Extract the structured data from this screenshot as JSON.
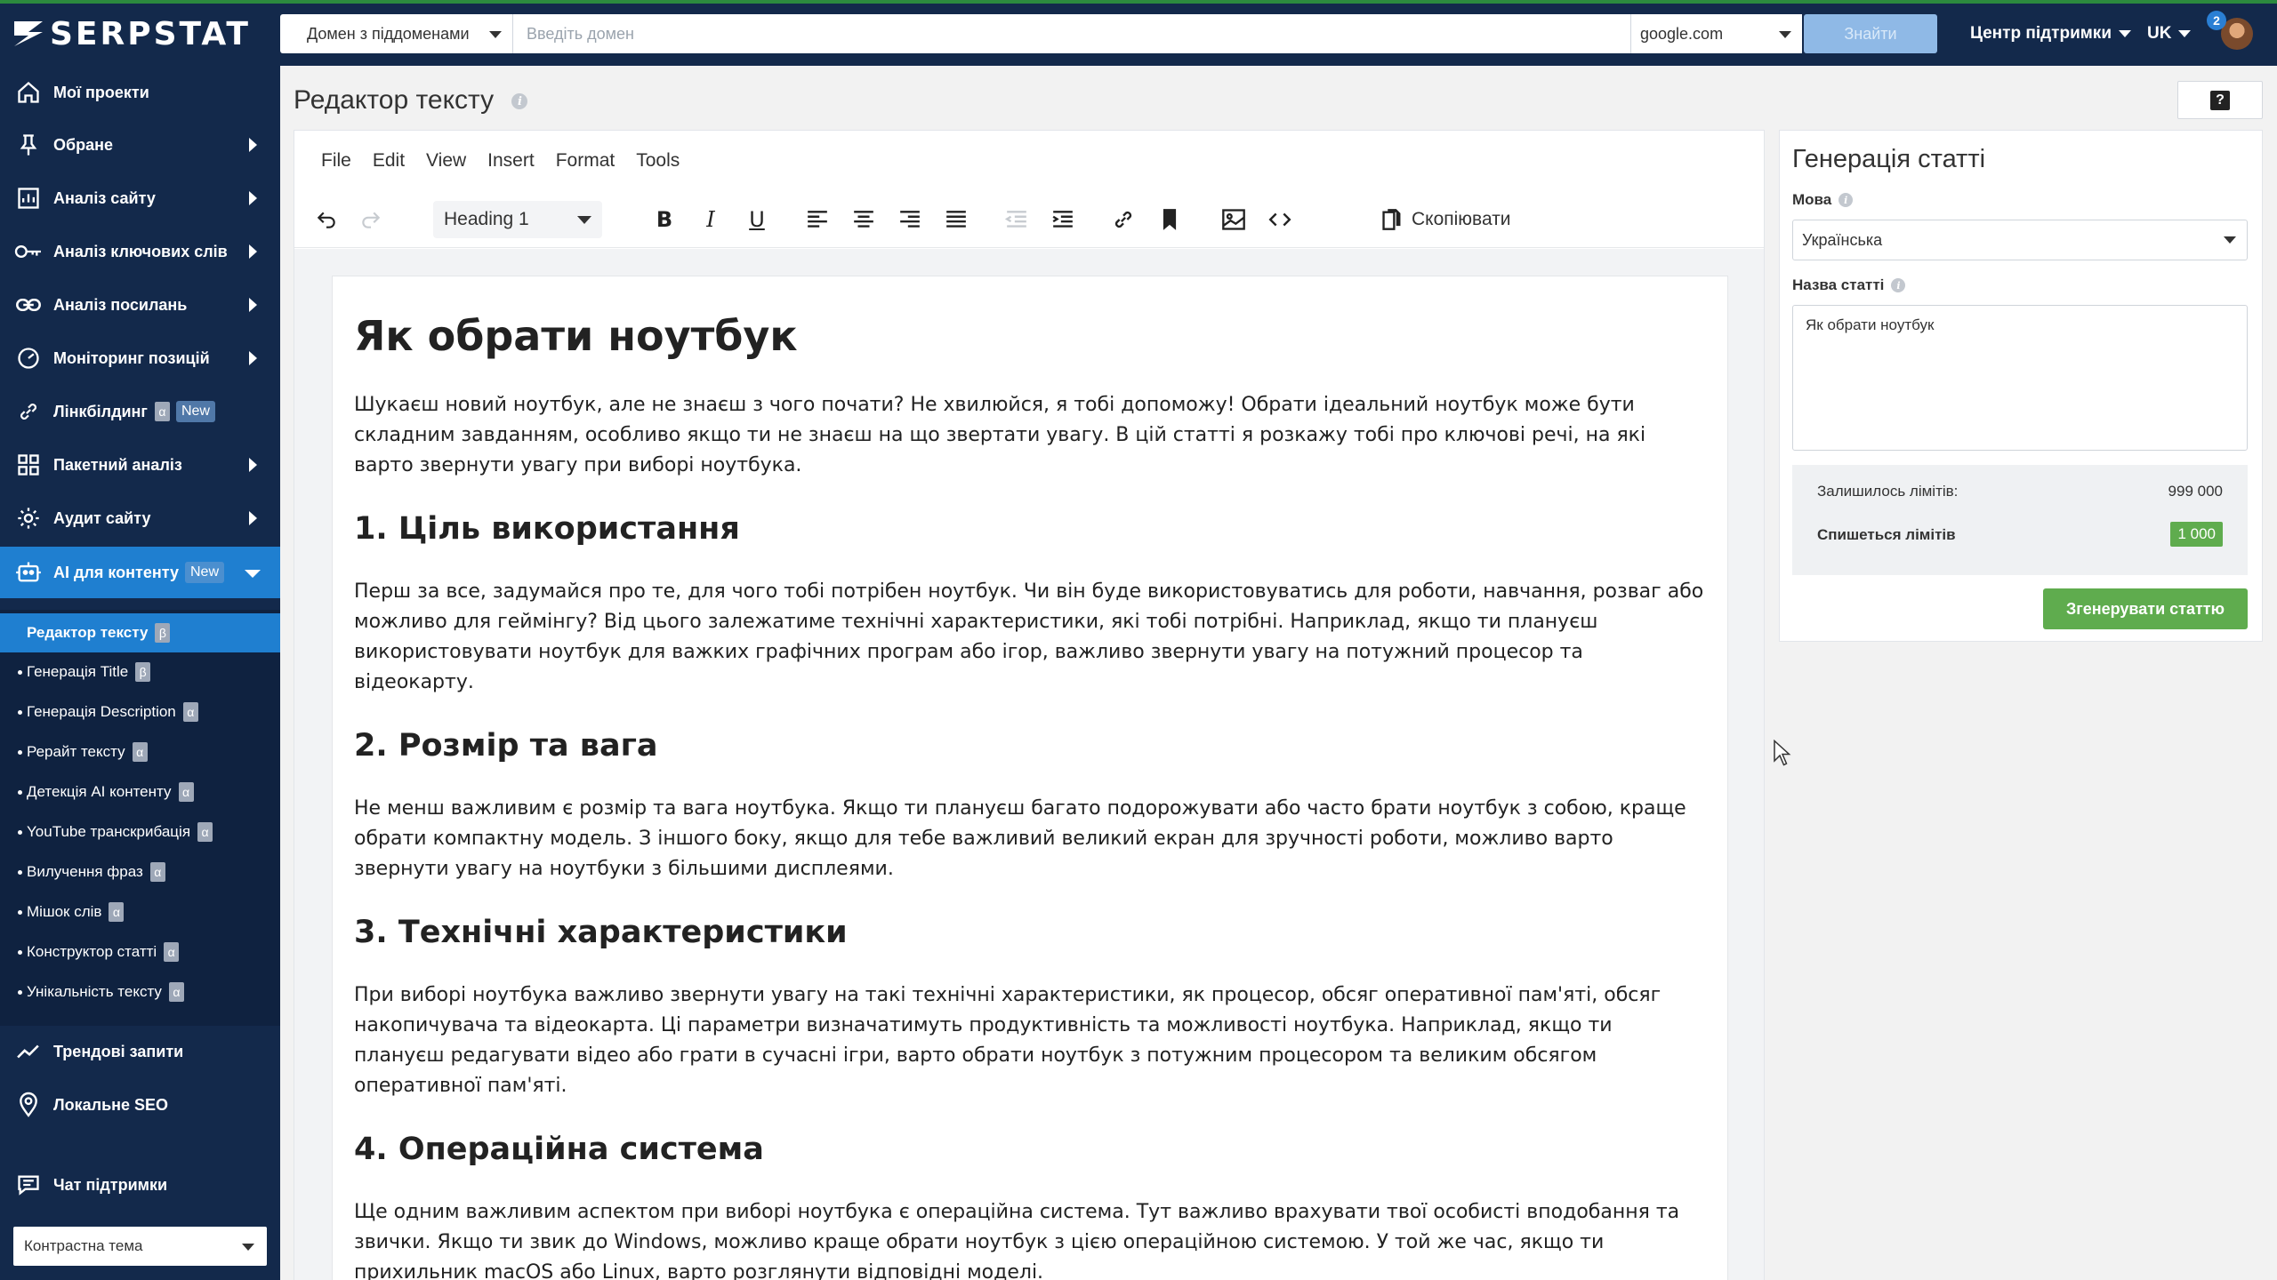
{
  "brand": {
    "logo_text": "SERPSTAT"
  },
  "topbar": {
    "domain_mode": "Домен з піддоменами",
    "search_placeholder": "Введіть домен",
    "search_value": "",
    "engine": "google.com",
    "find_button": "Знайти",
    "support_menu": "Центр підтримки",
    "language": "UK",
    "notifications_count": "2"
  },
  "sidebar": {
    "items": [
      {
        "label": "Мої проекти",
        "icon": "home-icon"
      },
      {
        "label": "Обране",
        "icon": "pin-icon"
      },
      {
        "label": "Аналіз сайту",
        "icon": "chart-icon"
      },
      {
        "label": "Аналіз ключових слів",
        "icon": "key-icon"
      },
      {
        "label": "Аналіз посилань",
        "icon": "link-icon"
      },
      {
        "label": "Моніторинг позицій",
        "icon": "monitor-icon"
      },
      {
        "label": "Лінкбілдинг",
        "icon": "chain-icon",
        "tag": "α",
        "badge": "New"
      },
      {
        "label": "Пакетний аналіз",
        "icon": "grid-icon"
      },
      {
        "label": "Аудит сайту",
        "icon": "gear-icon"
      },
      {
        "label": "AI для контенту",
        "icon": "robot-icon",
        "badge": "New"
      }
    ],
    "sub_items": [
      {
        "label": "Редактор тексту",
        "tag": "β"
      },
      {
        "label": "Генерація Title",
        "tag": "β"
      },
      {
        "label": "Генерація Description",
        "tag": "α"
      },
      {
        "label": "Рерайт тексту",
        "tag": "α"
      },
      {
        "label": "Детекція AI контенту",
        "tag": "α"
      },
      {
        "label": "YouTube транскрибація",
        "tag": "α"
      },
      {
        "label": "Вилучення фраз",
        "tag": "α"
      },
      {
        "label": "Мішок слів",
        "tag": "α"
      },
      {
        "label": "Конструктор статті",
        "tag": "α"
      },
      {
        "label": "Унікальність тексту",
        "tag": "α"
      }
    ],
    "bottom_items": [
      {
        "label": "Трендові запити",
        "icon": "trend-icon"
      },
      {
        "label": "Локальне SEO",
        "icon": "location-icon"
      },
      {
        "label": "Чат підтримки",
        "icon": "chat-icon"
      }
    ],
    "theme_select": "Контрастна тема"
  },
  "page": {
    "title": "Редактор тексту",
    "help": "?"
  },
  "editor": {
    "menu": [
      "File",
      "Edit",
      "View",
      "Insert",
      "Format",
      "Tools"
    ],
    "block_format": "Heading 1",
    "copy_label": "Скопіювати",
    "doc": {
      "h1": "Як обрати ноутбук",
      "intro": "Шукаєш новий ноутбук, але не знаєш з чого почати? Не хвилюйся, я тобі допоможу! Обрати ідеальний ноутбук може бути складним завданням, особливо якщо ти не знаєш на що звертати увагу. В цій статті я розкажу тобі про ключові речі, на які варто звернути увагу при виборі ноутбука.",
      "sections": [
        {
          "heading": "1. Ціль використання",
          "text": "Перш за все, задумайся про те, для чого тобі потрібен ноутбук. Чи він буде використовуватись для роботи, навчання, розваг або можливо для геймінгу? Від цього залежатиме технічні характеристики, які тобі потрібні. Наприклад, якщо ти плануєш використовувати ноутбук для важких графічних програм або ігор, важливо звернути увагу на потужний процесор та відеокарту."
        },
        {
          "heading": "2. Розмір та вага",
          "text": "Не менш важливим є розмір та вага ноутбука. Якщо ти плануєш багато подорожувати або часто брати ноутбук з собою, краще обрати компактну модель. З іншого боку, якщо для тебе важливий великий екран для зручності роботи, можливо варто звернути увагу на ноутбуки з більшими дисплеями."
        },
        {
          "heading": "3. Технічні характеристики",
          "text": "При виборі ноутбука важливо звернути увагу на такі технічні характеристики, як процесор, обсяг оперативної пам'яті, обсяг накопичувача та відеокарта. Ці параметри визначатимуть продуктивність та можливості ноутбука. Наприклад, якщо ти плануєш редагувати відео або грати в сучасні ігри, варто обрати ноутбук з потужним процесором та великим обсягом оперативної пам'яті."
        },
        {
          "heading": "4. Операційна система",
          "text": "Ще одним важливим аспектом при виборі ноутбука є операційна система. Тут важливо врахувати твої особисті вподобання та звички. Якщо ти звик до Windows, можливо краще обрати ноутбук з цією операційною системою. У той же час, якщо ти прихильник macOS або Linux, варто розглянути відповідні моделі."
        }
      ]
    }
  },
  "generator": {
    "title": "Генерація статті",
    "language_label": "Мова",
    "language_value": "Українська",
    "article_name_label": "Назва статті",
    "article_name_value": "Як обрати ноутбук",
    "limits_left_label": "Залишилось лімітів:",
    "limits_left_value": "999 000",
    "limits_charge_label": "Спишеться лімітів",
    "limits_charge_value": "1 000",
    "generate_button": "Згенерувати статтю"
  },
  "colors": {
    "sidebar_bg": "#13294b",
    "active_blue": "#1f7fd0",
    "accent_green": "#5fac4e"
  }
}
